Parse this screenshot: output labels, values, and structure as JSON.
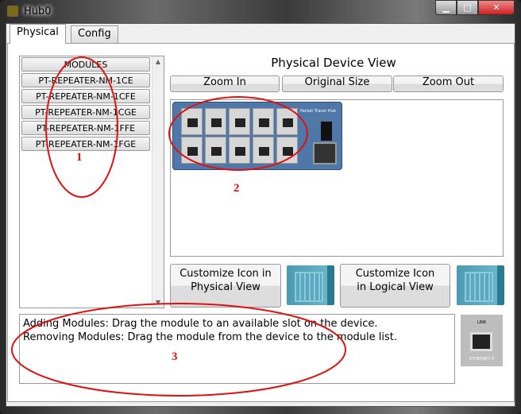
{
  "window": {
    "title": "Hub0"
  },
  "tabs": [
    {
      "label": "Physical"
    },
    {
      "label": "Config"
    }
  ],
  "modules": {
    "header": "MODULES",
    "items": [
      "PT-REPEATER-NM-1CE",
      "PT-REPEATER-NM-1CFE",
      "PT-REPEATER-NM-1CGE",
      "PT-REPEATER-NM-1FFE",
      "PT-REPEATER-NM-1FGE"
    ]
  },
  "device_view": {
    "title": "Physical Device View",
    "zoom_in": "Zoom In",
    "original_size": "Original Size",
    "zoom_out": "Zoom Out",
    "hub_label": "Packet Tracer Hub"
  },
  "customize": {
    "physical": "Customize Icon in Physical View",
    "logical": "Customize Icon in Logical View"
  },
  "info": {
    "line1": "Adding Modules: Drag the module to an available slot on the device.",
    "line2": "Removing Modules: Drag the module from the device to the module list."
  },
  "port_preview": {
    "top": "LINK",
    "bottom": "ETHERNET 0"
  },
  "annotations": [
    "1",
    "2",
    "3"
  ],
  "colors": {
    "annotation": "#e01010",
    "hub": "#4f78a8"
  }
}
